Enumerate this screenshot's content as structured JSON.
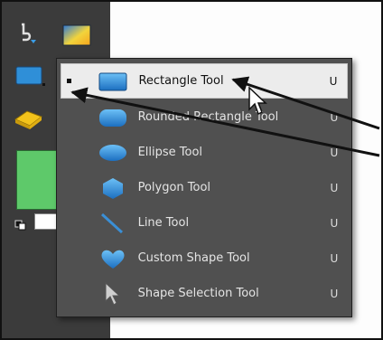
{
  "flyout": {
    "items": [
      {
        "label": "Rectangle Tool",
        "shortcut": "U",
        "icon": "rectangle-shape-icon",
        "selected": true
      },
      {
        "label": "Rounded Rectangle Tool",
        "shortcut": "U",
        "icon": "rounded-rectangle-shape-icon",
        "selected": false
      },
      {
        "label": "Ellipse Tool",
        "shortcut": "U",
        "icon": "ellipse-shape-icon",
        "selected": false
      },
      {
        "label": "Polygon Tool",
        "shortcut": "U",
        "icon": "polygon-shape-icon",
        "selected": false
      },
      {
        "label": "Line Tool",
        "shortcut": "U",
        "icon": "line-shape-icon",
        "selected": false
      },
      {
        "label": "Custom Shape Tool",
        "shortcut": "U",
        "icon": "custom-shape-heart-icon",
        "selected": false
      },
      {
        "label": "Shape Selection Tool",
        "shortcut": "U",
        "icon": "shape-selection-arrow-icon",
        "selected": false
      }
    ]
  },
  "toolbar": {
    "tools": [
      "pen-tool-icon",
      "gradient-tool-icon",
      "rectangle-tool-icon",
      "eraser-paint-bucket-icon",
      "foreground-color-swatch",
      "default-colors-icon"
    ]
  },
  "colors": {
    "toolbar_bg": "#3b3b3b",
    "flyout_bg": "#505050",
    "selected_bg": "#ececec",
    "shape_blue": "#2f8fd8",
    "foreground_swatch": "#5ec96a",
    "arrow_color": "#111111"
  }
}
